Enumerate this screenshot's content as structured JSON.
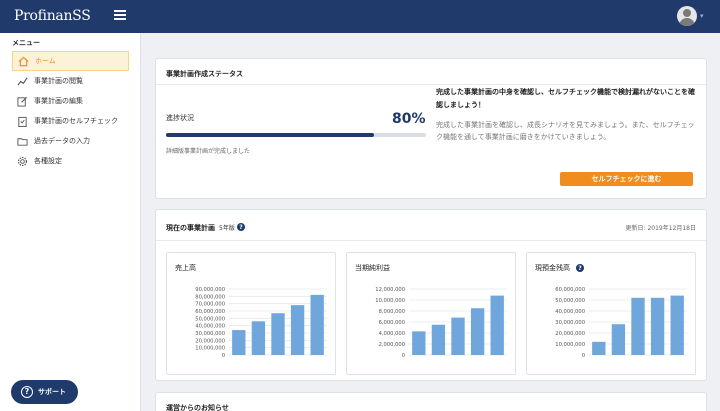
{
  "header": {
    "logo": "ProfinanSS"
  },
  "sidebar": {
    "menu_label": "メニュー",
    "items": [
      {
        "label": "ホーム",
        "icon": "home-icon",
        "active": true
      },
      {
        "label": "事業計画の閲覧",
        "icon": "trend-line-icon",
        "active": false
      },
      {
        "label": "事業計画の編集",
        "icon": "edit-icon",
        "active": false
      },
      {
        "label": "事業計画のセルフチェック",
        "icon": "clipboard-check-icon",
        "active": false
      },
      {
        "label": "過去データの入力",
        "icon": "folder-icon",
        "active": false
      },
      {
        "label": "各種設定",
        "icon": "gear-icon",
        "active": false
      }
    ],
    "support_label": "サポート"
  },
  "status": {
    "title": "事業計画作成ステータス",
    "progress_label": "進捗状況",
    "progress_percent": "80%",
    "progress_value": 0.8,
    "progress_note": "詳細版事業計画が完成しました",
    "headline": "完成した事業計画の中身を確認し、セルフチェック機能で検討漏れがないことを確認しましょう！",
    "body": "完成した事業計画を確認し、成長シナリオを見てみましょう。また、セルフチェック機能を通して事業計画に磨きをかけていきましょう。",
    "button_label": "セルフチェックに進む"
  },
  "plan": {
    "title": "現在の事業計画",
    "version": "5年版",
    "updated": "更新日: 2019年12月18日"
  },
  "chart_data": [
    {
      "type": "bar",
      "title": "売上高",
      "categories": [
        "1",
        "2",
        "3",
        "4",
        "5"
      ],
      "values": [
        34000000,
        46000000,
        57000000,
        68000000,
        82000000
      ],
      "ylim": [
        0,
        90000000
      ],
      "yticks": [
        "90,000,000",
        "80,000,000",
        "70,000,000",
        "60,000,000",
        "50,000,000",
        "40,000,000",
        "30,000,000",
        "20,000,000",
        "10,000,000",
        "0"
      ],
      "grid": true
    },
    {
      "type": "bar",
      "title": "当期純利益",
      "categories": [
        "1",
        "2",
        "3",
        "4",
        "5"
      ],
      "values": [
        4300000,
        5500000,
        6800000,
        8500000,
        10800000
      ],
      "ylim": [
        0,
        12000000
      ],
      "yticks": [
        "12,000,000",
        "10,000,000",
        "8,000,000",
        "6,000,000",
        "4,000,000",
        "2,000,000",
        "0"
      ],
      "grid": true
    },
    {
      "type": "bar",
      "title": "現預金残高",
      "categories": [
        "1",
        "2",
        "3",
        "4",
        "5"
      ],
      "values": [
        12000000,
        28000000,
        52000000,
        52000000,
        54000000
      ],
      "ylim": [
        0,
        60000000
      ],
      "yticks": [
        "60,000,000",
        "50,000,000",
        "40,000,000",
        "30,000,000",
        "20,000,000",
        "10,000,000",
        "0"
      ],
      "grid": true,
      "help": "?"
    }
  ],
  "notice": {
    "title": "運営からのお知らせ"
  },
  "colors": {
    "navy": "#1f3a6b",
    "accent": "#f08d1e",
    "bar": "#6fa6dc",
    "active_bg": "#fdf1d8"
  }
}
